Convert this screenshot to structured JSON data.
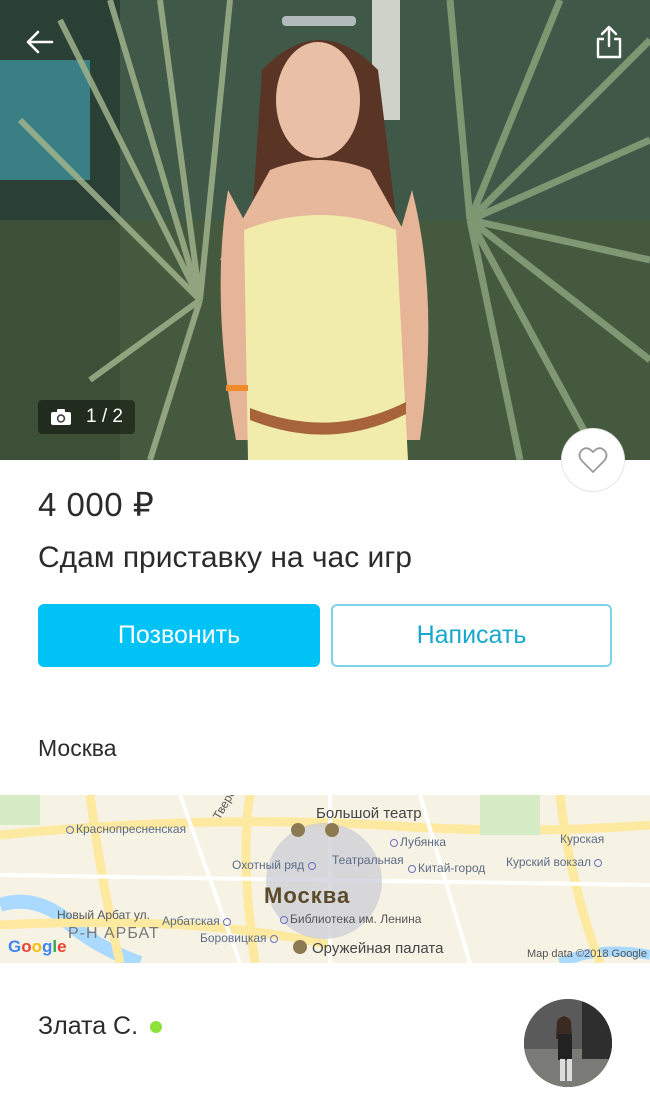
{
  "hero": {
    "photo_counter": "1 / 2",
    "icons": {
      "back": "arrow-left-icon",
      "share": "share-icon",
      "camera": "camera-icon",
      "favorite": "heart-icon"
    }
  },
  "listing": {
    "price": "4 000 ₽",
    "title": "Сдам приставку на час игр"
  },
  "actions": {
    "call_label": "Позвонить",
    "message_label": "Написать",
    "accent_color": "#00c2f5"
  },
  "location": {
    "city": "Москва",
    "map": {
      "city_label": "Москва",
      "district": "Р-Н АРБАТ",
      "labels": {
        "bolshoi": "Большой театр",
        "krasnopresnenskaya": "Краснопресненская",
        "tverskoy": "Тверской б.",
        "lubyanka": "Лубянка",
        "kurskaya": "Курская",
        "okhotny": "Охотный ряд",
        "teatralnaya": "Театральная",
        "kitay": "Китай-город",
        "kursky_vokzal": "Курский вокзал",
        "novy_arbat": "Новый Арбат ул.",
        "arbatskaya": "Арбатская",
        "biblioteka": "Библиотека им. Ленина",
        "borovitskaya": "Боровицкая",
        "armoury": "Оружейная палата"
      },
      "google": "Google",
      "attribution": "Map data ©2018 Google"
    }
  },
  "seller": {
    "name": "Злата С.",
    "online": true,
    "online_color": "#8ee03a"
  }
}
